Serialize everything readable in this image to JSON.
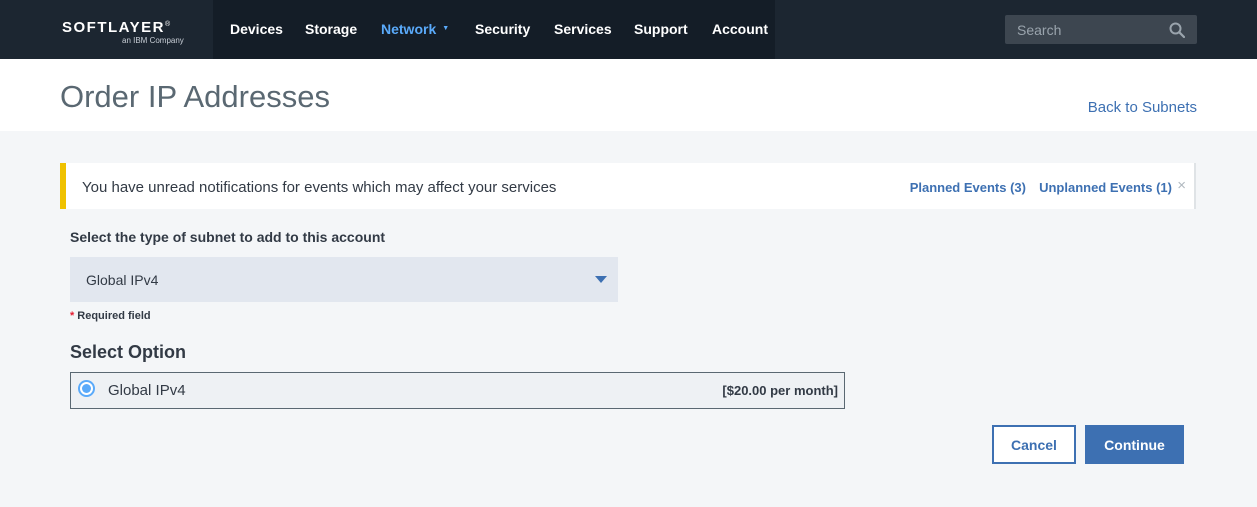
{
  "brand": {
    "logo": "SOFTLAYER",
    "logo_mark": "®",
    "sub": "an IBM Company"
  },
  "nav": {
    "items": [
      {
        "label": "Devices"
      },
      {
        "label": "Storage"
      },
      {
        "label": "Network",
        "active": true,
        "has_dropdown": true
      },
      {
        "label": "Security"
      },
      {
        "label": "Services"
      },
      {
        "label": "Support"
      },
      {
        "label": "Account"
      }
    ]
  },
  "search": {
    "placeholder": "Search"
  },
  "page": {
    "title": "Order IP Addresses",
    "back_link": "Back to Subnets"
  },
  "notification": {
    "text": "You have unread notifications for events which may affect your services",
    "planned": "Planned Events (3)",
    "unplanned": "Unplanned Events (1)",
    "close": "×"
  },
  "form": {
    "subnet_label": "Select the type of subnet to add to this account",
    "subnet_selected": "Global IPv4",
    "required_star": "*",
    "required_text": "Required field",
    "section_title": "Select Option",
    "option": {
      "label": "Global IPv4",
      "price": "[$20.00 per month]",
      "selected": true
    }
  },
  "actions": {
    "cancel": "Cancel",
    "continue": "Continue"
  },
  "colors": {
    "nav_bg": "#1c2631",
    "link": "#3d70b2",
    "active_nav": "#5aaafa",
    "warning": "#efc100"
  }
}
